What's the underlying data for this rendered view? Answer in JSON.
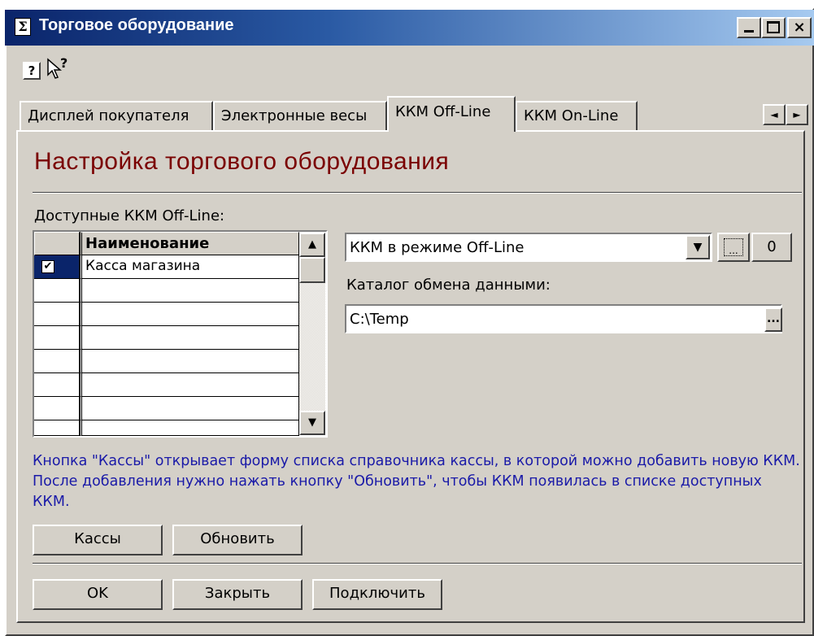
{
  "window": {
    "title": "Торговое оборудование",
    "icon": "sum-icon",
    "min": "_",
    "max": "□",
    "close": "×"
  },
  "toolbar": {
    "help_icon": "?",
    "context_help_icon": "?"
  },
  "tabs": [
    {
      "label": "Дисплей покупателя",
      "active": false
    },
    {
      "label": "Электронные весы",
      "active": false
    },
    {
      "label": "ККМ Off-Line",
      "active": true
    },
    {
      "label": "ККМ On-Line",
      "active": false
    }
  ],
  "tab_scroll": {
    "left": "◄",
    "right": "►"
  },
  "main": {
    "heading": "Настройка торгового оборудования",
    "available_label": "Доступные ККМ Off-Line:",
    "grid": {
      "header": "Наименование",
      "rows": [
        {
          "checked": true,
          "name": "Касса магазина"
        },
        {
          "checked": false,
          "name": ""
        },
        {
          "checked": false,
          "name": ""
        },
        {
          "checked": false,
          "name": ""
        },
        {
          "checked": false,
          "name": ""
        },
        {
          "checked": false,
          "name": ""
        },
        {
          "checked": false,
          "name": ""
        }
      ]
    },
    "device_select": {
      "value": "ККМ в режиме Off-Line"
    },
    "dots_button": "...",
    "zero_button": "0",
    "exchange_label": "Каталог обмена данными:",
    "exchange_path": {
      "value": "C:\\Temp"
    },
    "browse_button": "...",
    "info_text": "Кнопка \"Кассы\" открывает форму списка справочника кассы, в которой можно добавить новую ККМ. После добавления нужно нажать кнопку \"Обновить\", чтобы ККМ появилась в списке доступных ККМ.",
    "cash_button": "Кассы",
    "refresh_button": "Обновить"
  },
  "footer": {
    "ok": "OK",
    "close": "Закрыть",
    "connect": "Подключить"
  }
}
